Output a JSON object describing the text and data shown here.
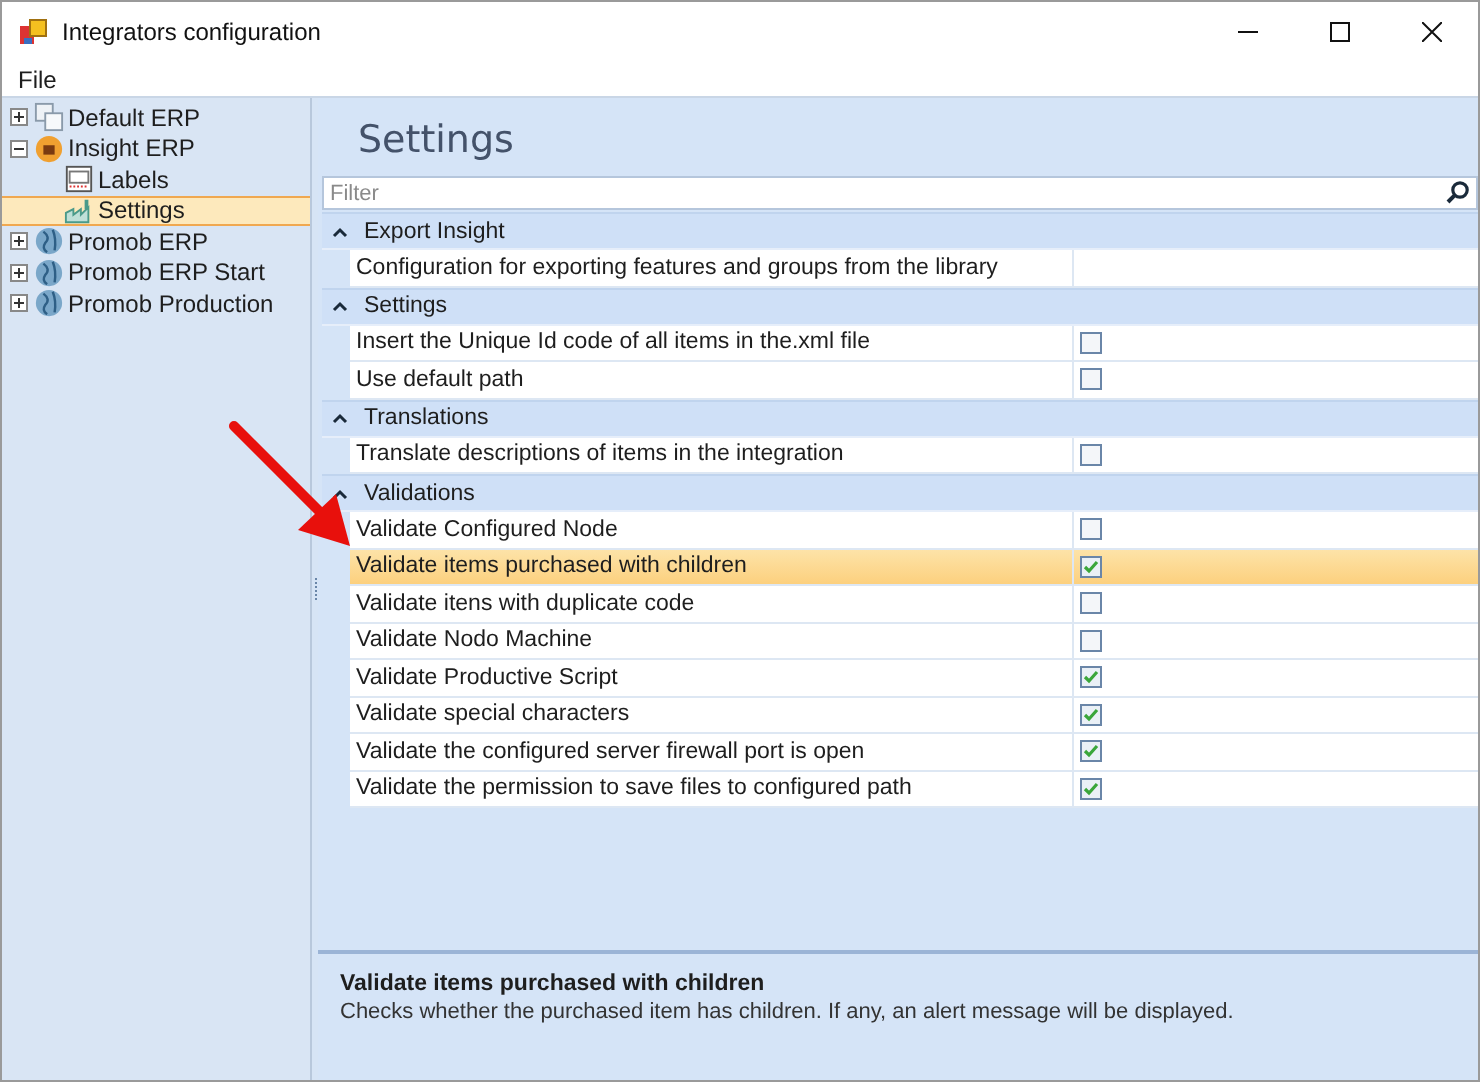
{
  "window": {
    "title": "Integrators configuration"
  },
  "menu": [
    "File"
  ],
  "tree": [
    {
      "label": "Default ERP",
      "kind": "erp",
      "expanded": false,
      "selected": false
    },
    {
      "label": "Insight ERP",
      "kind": "insight",
      "expanded": true,
      "selected": false,
      "children": [
        {
          "label": "Labels",
          "kind": "labels",
          "selected": false
        },
        {
          "label": "Settings",
          "kind": "settings",
          "selected": true
        }
      ]
    },
    {
      "label": "Promob ERP",
      "kind": "globe",
      "expanded": false,
      "selected": false
    },
    {
      "label": "Promob ERP Start",
      "kind": "globe",
      "expanded": false,
      "selected": false
    },
    {
      "label": "Promob Production",
      "kind": "globe",
      "expanded": false,
      "selected": false
    }
  ],
  "heading": "Settings",
  "filter": {
    "placeholder": "Filter"
  },
  "sections": [
    {
      "title": "Export Insight",
      "expanded": true,
      "rows": [
        {
          "label": "Configuration for exporting features and groups from the library",
          "kind": "text",
          "selected": false
        }
      ]
    },
    {
      "title": "Settings",
      "expanded": true,
      "rows": [
        {
          "label": "Insert the Unique Id code of all items in the.xml file",
          "kind": "checkbox",
          "checked": false,
          "selected": false
        },
        {
          "label": "Use default path",
          "kind": "checkbox",
          "checked": false,
          "selected": false
        }
      ]
    },
    {
      "title": "Translations",
      "expanded": true,
      "rows": [
        {
          "label": "Translate descriptions of items in the integration",
          "kind": "checkbox",
          "checked": false,
          "selected": false
        }
      ]
    },
    {
      "title": "Validations",
      "expanded": true,
      "rows": [
        {
          "label": "Validate Configured Node",
          "kind": "checkbox",
          "checked": false,
          "selected": false
        },
        {
          "label": "Validate items purchased with children",
          "kind": "checkbox",
          "checked": true,
          "selected": true
        },
        {
          "label": "Validate itens with duplicate code",
          "kind": "checkbox",
          "checked": false,
          "selected": false
        },
        {
          "label": "Validate Nodo Machine",
          "kind": "checkbox",
          "checked": false,
          "selected": false
        },
        {
          "label": "Validate Productive Script",
          "kind": "checkbox",
          "checked": true,
          "selected": false
        },
        {
          "label": "Validate special characters",
          "kind": "checkbox",
          "checked": true,
          "selected": false
        },
        {
          "label": "Validate the configured server firewall port is open",
          "kind": "checkbox",
          "checked": true,
          "selected": false
        },
        {
          "label": "Validate the permission to save files to configured path",
          "kind": "checkbox",
          "checked": true,
          "selected": false
        }
      ]
    }
  ],
  "description": {
    "title": "Validate items purchased with children",
    "text": "Checks whether the purchased item has children. If any, an alert message will be displayed."
  }
}
